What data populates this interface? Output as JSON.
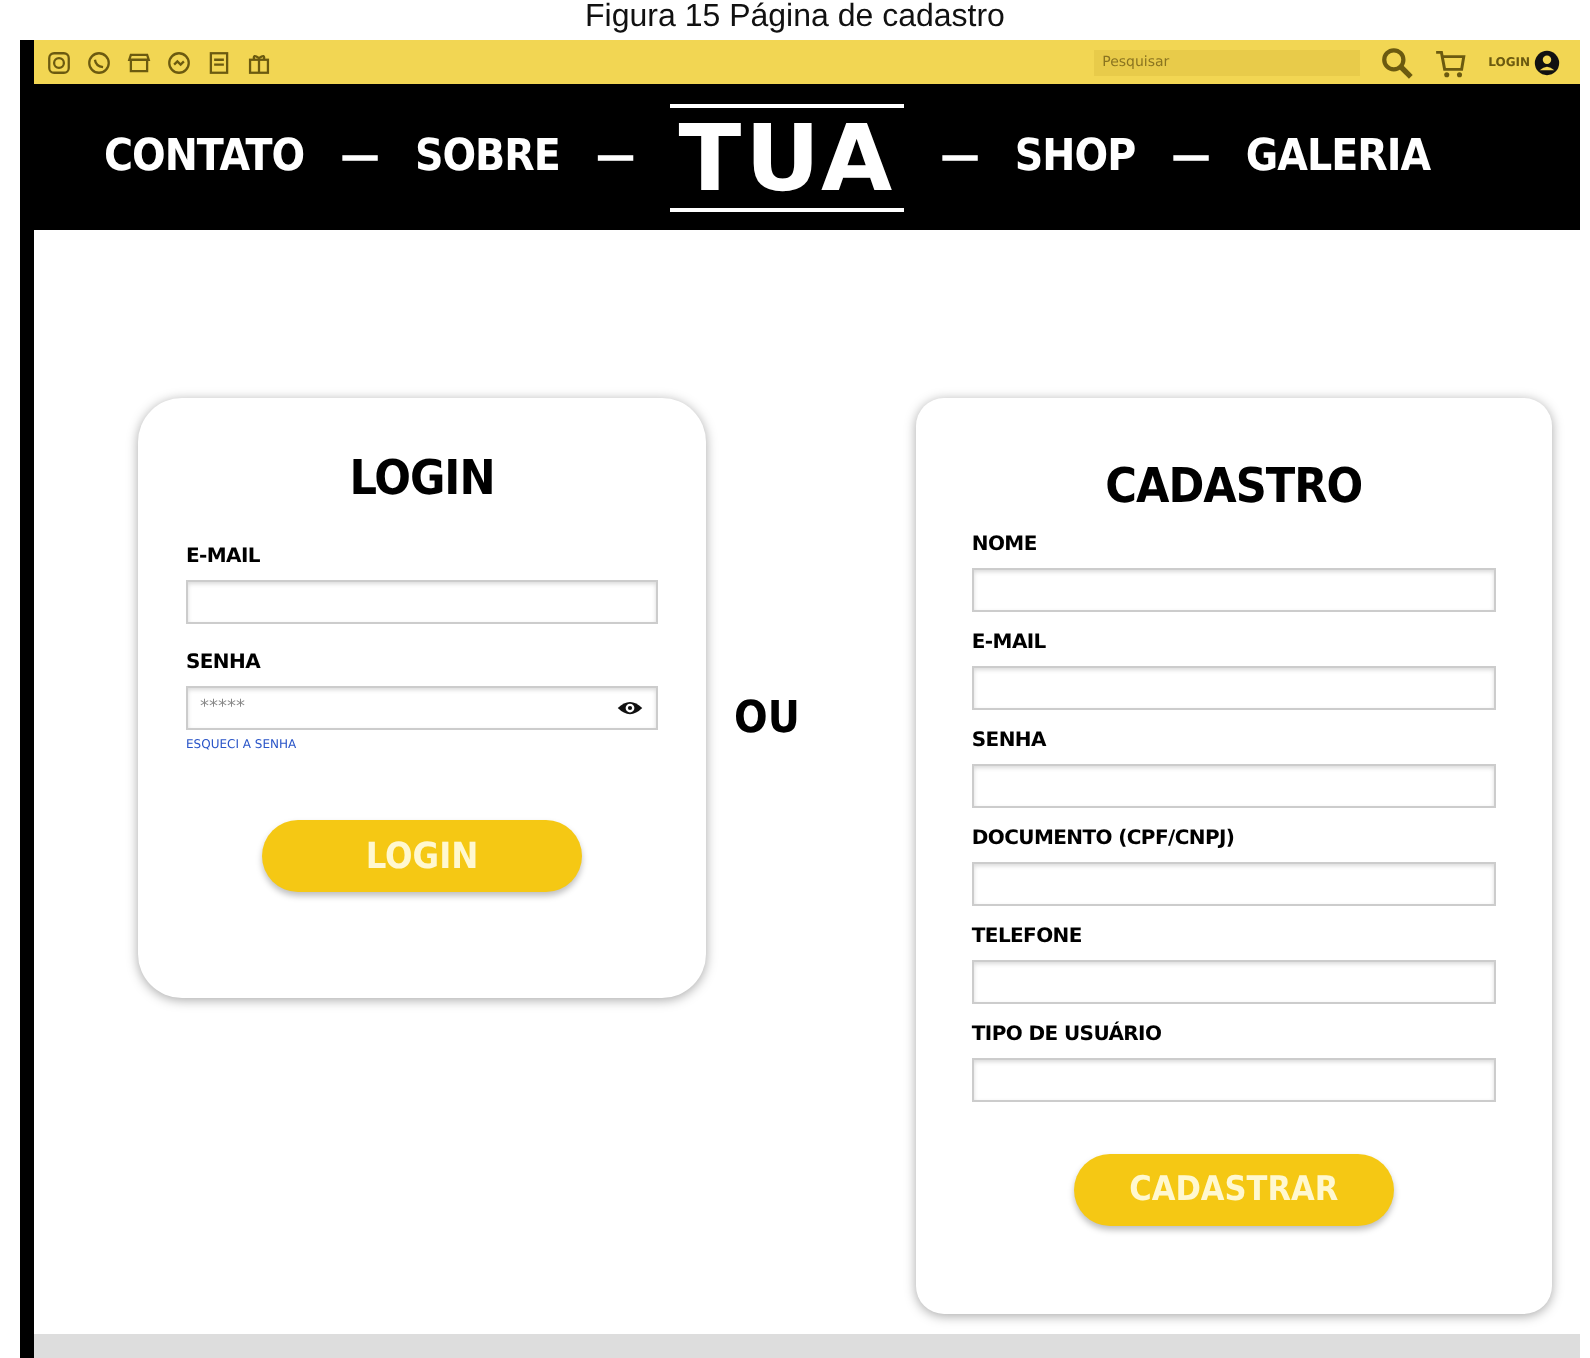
{
  "caption": "Figura 15 Página de cadastro",
  "top_bar": {
    "search": {
      "placeholder": "Pesquisar"
    },
    "login_label": "LOGIN"
  },
  "nav": [
    {
      "kind": "link",
      "label": "CONTATO"
    },
    {
      "kind": "dash",
      "label": "—"
    },
    {
      "kind": "link",
      "label": "SOBRE"
    },
    {
      "kind": "dash",
      "label": "—"
    },
    {
      "kind": "logo",
      "label": "TUA"
    },
    {
      "kind": "dash",
      "label": "—"
    },
    {
      "kind": "link",
      "label": "SHOP"
    },
    {
      "kind": "dash",
      "label": "—"
    },
    {
      "kind": "link",
      "label": "GALERIA"
    }
  ],
  "login": {
    "title": "LOGIN",
    "fields": [
      {
        "label": "E-MAIL",
        "kind": "text"
      },
      {
        "label": "SENHA",
        "kind": "password",
        "value": "*****"
      }
    ],
    "forgot_link": "ESQUECI A SENHA",
    "button": "LOGIN"
  },
  "separator": "OU",
  "signup": {
    "title": "CADASTRO",
    "fields": [
      {
        "label": "NOME",
        "kind": "text"
      },
      {
        "label": "E-MAIL",
        "kind": "text"
      },
      {
        "label": "SENHA",
        "kind": "text"
      },
      {
        "label": "DOCUMENTO (CPF/CNPJ)",
        "kind": "text"
      },
      {
        "label": "TELEFONE",
        "kind": "text"
      },
      {
        "label": "TIPO DE USUÁRIO",
        "kind": "text"
      }
    ],
    "button": "CADASTRAR"
  }
}
